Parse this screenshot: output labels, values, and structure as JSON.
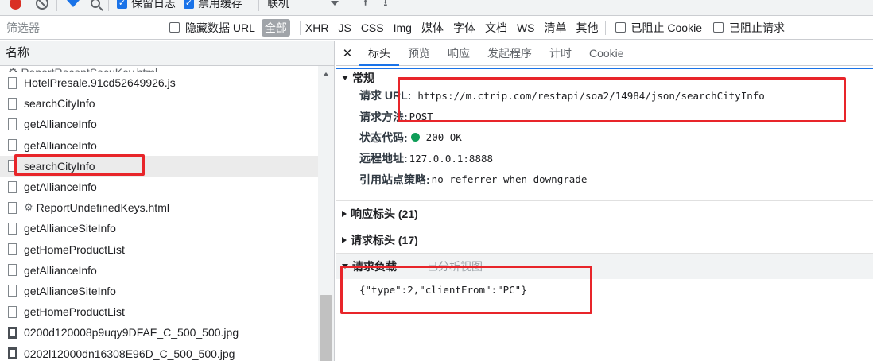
{
  "toolbar": {
    "preserve_log_label": "保留日志",
    "disable_cache_label": "禁用缓存",
    "throttle_value": "联机"
  },
  "filterbar": {
    "filter_placeholder": "筛选器",
    "hide_data_urls_label": "隐藏数据 URL",
    "all_label": "全部",
    "types": [
      "XHR",
      "JS",
      "CSS",
      "Img",
      "媒体",
      "字体",
      "文档",
      "WS",
      "清单",
      "其他"
    ],
    "blocked_cookies_label": "已阻止 Cookie",
    "blocked_requests_label": "已阻止请求"
  },
  "request_list": {
    "column_header": "名称",
    "partial_row": "⚙ ReportRecentSecuKey.html",
    "rows": [
      {
        "name": "HotelPresale.91cd52649926.js",
        "type": "file"
      },
      {
        "name": "searchCityInfo",
        "type": "file"
      },
      {
        "name": "getAllianceInfo",
        "type": "file"
      },
      {
        "name": "getAllianceInfo",
        "type": "file"
      },
      {
        "name": "searchCityInfo",
        "type": "file",
        "selected": true
      },
      {
        "name": "getAllianceInfo",
        "type": "file"
      },
      {
        "name": "ReportUndefinedKeys.html",
        "type": "file",
        "gear": true
      },
      {
        "name": "getAllianceSiteInfo",
        "type": "file"
      },
      {
        "name": "getHomeProductList",
        "type": "file"
      },
      {
        "name": "getAllianceInfo",
        "type": "file"
      },
      {
        "name": "getAllianceSiteInfo",
        "type": "file"
      },
      {
        "name": "getHomeProductList",
        "type": "file"
      },
      {
        "name": "0200d120008p9uqy9DFAF_C_500_500.jpg",
        "type": "image"
      },
      {
        "name": "0202l12000dn16308E96D_C_500_500.jpg",
        "type": "image"
      }
    ]
  },
  "detail_tabs": {
    "close": "✕",
    "tabs": [
      "标头",
      "预览",
      "响应",
      "发起程序",
      "计时",
      "Cookie"
    ],
    "active": "标头"
  },
  "general": {
    "title": "常规",
    "request_url_label": "请求 URL:",
    "request_url": "https://m.ctrip.com/restapi/soa2/14984/json/searchCityInfo",
    "method_label": "请求方法:",
    "method": "POST",
    "status_label": "状态代码:",
    "status": "200 OK",
    "status_color": "#0f9d58",
    "remote_label": "远程地址:",
    "remote": "127.0.0.1:8888",
    "referrer_label": "引用站点策略:",
    "referrer": "no-referrer-when-downgrade"
  },
  "response_headers": {
    "title": "响应标头 (21)"
  },
  "request_headers": {
    "title": "请求标头 (17)"
  },
  "payload": {
    "title": "请求负载",
    "hint": "已分析视图",
    "body": "{\"type\":2,\"clientFrom\":\"PC\"}"
  },
  "colors": {
    "accent": "#1a73e8",
    "record": "#d93025",
    "annotation": "#e8252a"
  }
}
